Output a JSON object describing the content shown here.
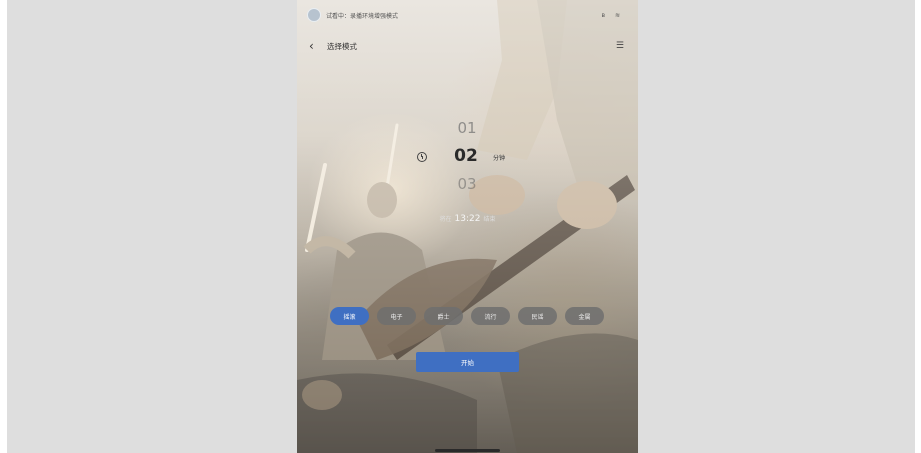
{
  "status_bar": {
    "mode_text": "试看中：录播环境增强模式",
    "icons": [
      "avatar",
      "bluetooth-icon",
      "wifi-icon"
    ]
  },
  "header": {
    "back_icon": "‹",
    "title": "选择模式",
    "menu_icon": "☰"
  },
  "timer": {
    "previous": "01",
    "current": "02",
    "next": "03",
    "unit": "分钟"
  },
  "end_time": {
    "prefix": "将在",
    "time": "13:22",
    "suffix": "结束"
  },
  "modes": [
    {
      "label": "摇滚",
      "active": true
    },
    {
      "label": "电子",
      "active": false
    },
    {
      "label": "爵士",
      "active": false
    },
    {
      "label": "流行",
      "active": false
    },
    {
      "label": "民谣",
      "active": false
    },
    {
      "label": "金属",
      "active": false
    }
  ],
  "actions": {
    "start_label": "开始"
  },
  "colors": {
    "accent": "#3f6fc2",
    "chip_inactive": "#6e6e6e",
    "desktop_bg": "#dedede"
  }
}
